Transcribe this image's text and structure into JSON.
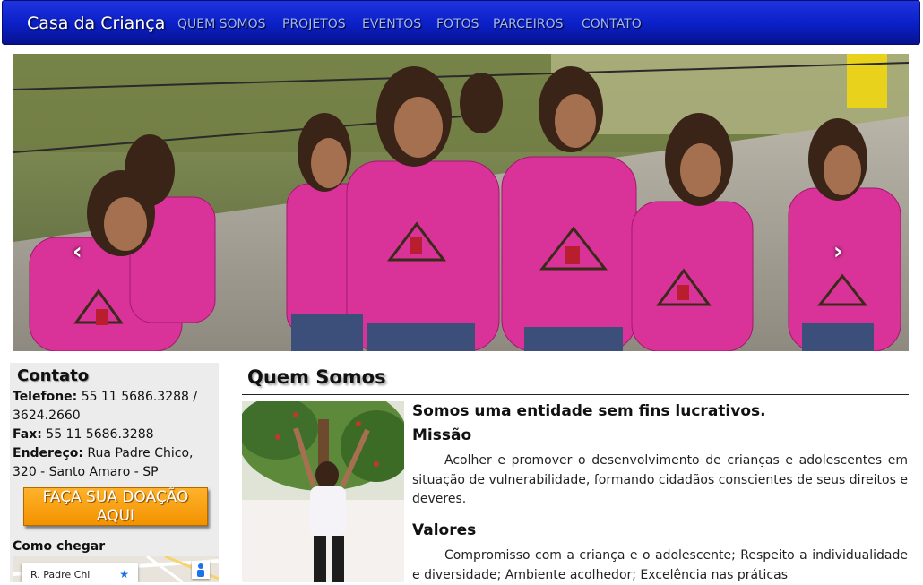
{
  "navbar": {
    "brand": "Casa da Criança",
    "items": [
      "QUEM SOMOS",
      "PROJETOS",
      "EVENTOS",
      "FOTOS",
      "PARCEIROS",
      "CONTATO"
    ]
  },
  "carousel": {
    "prev_icon": "chevron-left-icon",
    "next_icon": "chevron-right-icon",
    "prev_glyph": "‹",
    "next_glyph": "›",
    "slide_count": 4,
    "active_index": 3,
    "shirt_color": "#d9339a"
  },
  "sidebar": {
    "title": "Contato",
    "phone_label": "Telefone:",
    "phone_value": "55 11 5686.3288 / 3624.2660",
    "fax_label": "Fax:",
    "fax_value": "55 11 5686.3288",
    "address_label": "Endereço:",
    "address_value": "Rua Padre Chico, 320 - Santo Amaro - SP",
    "donate_button": "FAÇA SUA DOAÇÃO AQUI",
    "directions_title": "Como chegar",
    "map_label": "R. Padre Chi"
  },
  "main": {
    "title": "Quem Somos",
    "lead": "Somos uma entidade sem fins lucrativos.",
    "mission_heading": "Missão",
    "mission_text": "Acolher e promover o desenvolvimento de crianças e adolescentes em situação de vulnerabilidade, formando cidadãos conscientes de seus direitos e deveres.",
    "values_heading": "Valores",
    "values_text": "Compromisso com a criança e o adolescente; Respeito a individualidade e diversidade; Ambiente acolhedor; Excelência nas práticas"
  },
  "colors": {
    "navbar": "#0b1fc6",
    "nav_text": "#9fb5ff",
    "donate": "#f39200"
  }
}
